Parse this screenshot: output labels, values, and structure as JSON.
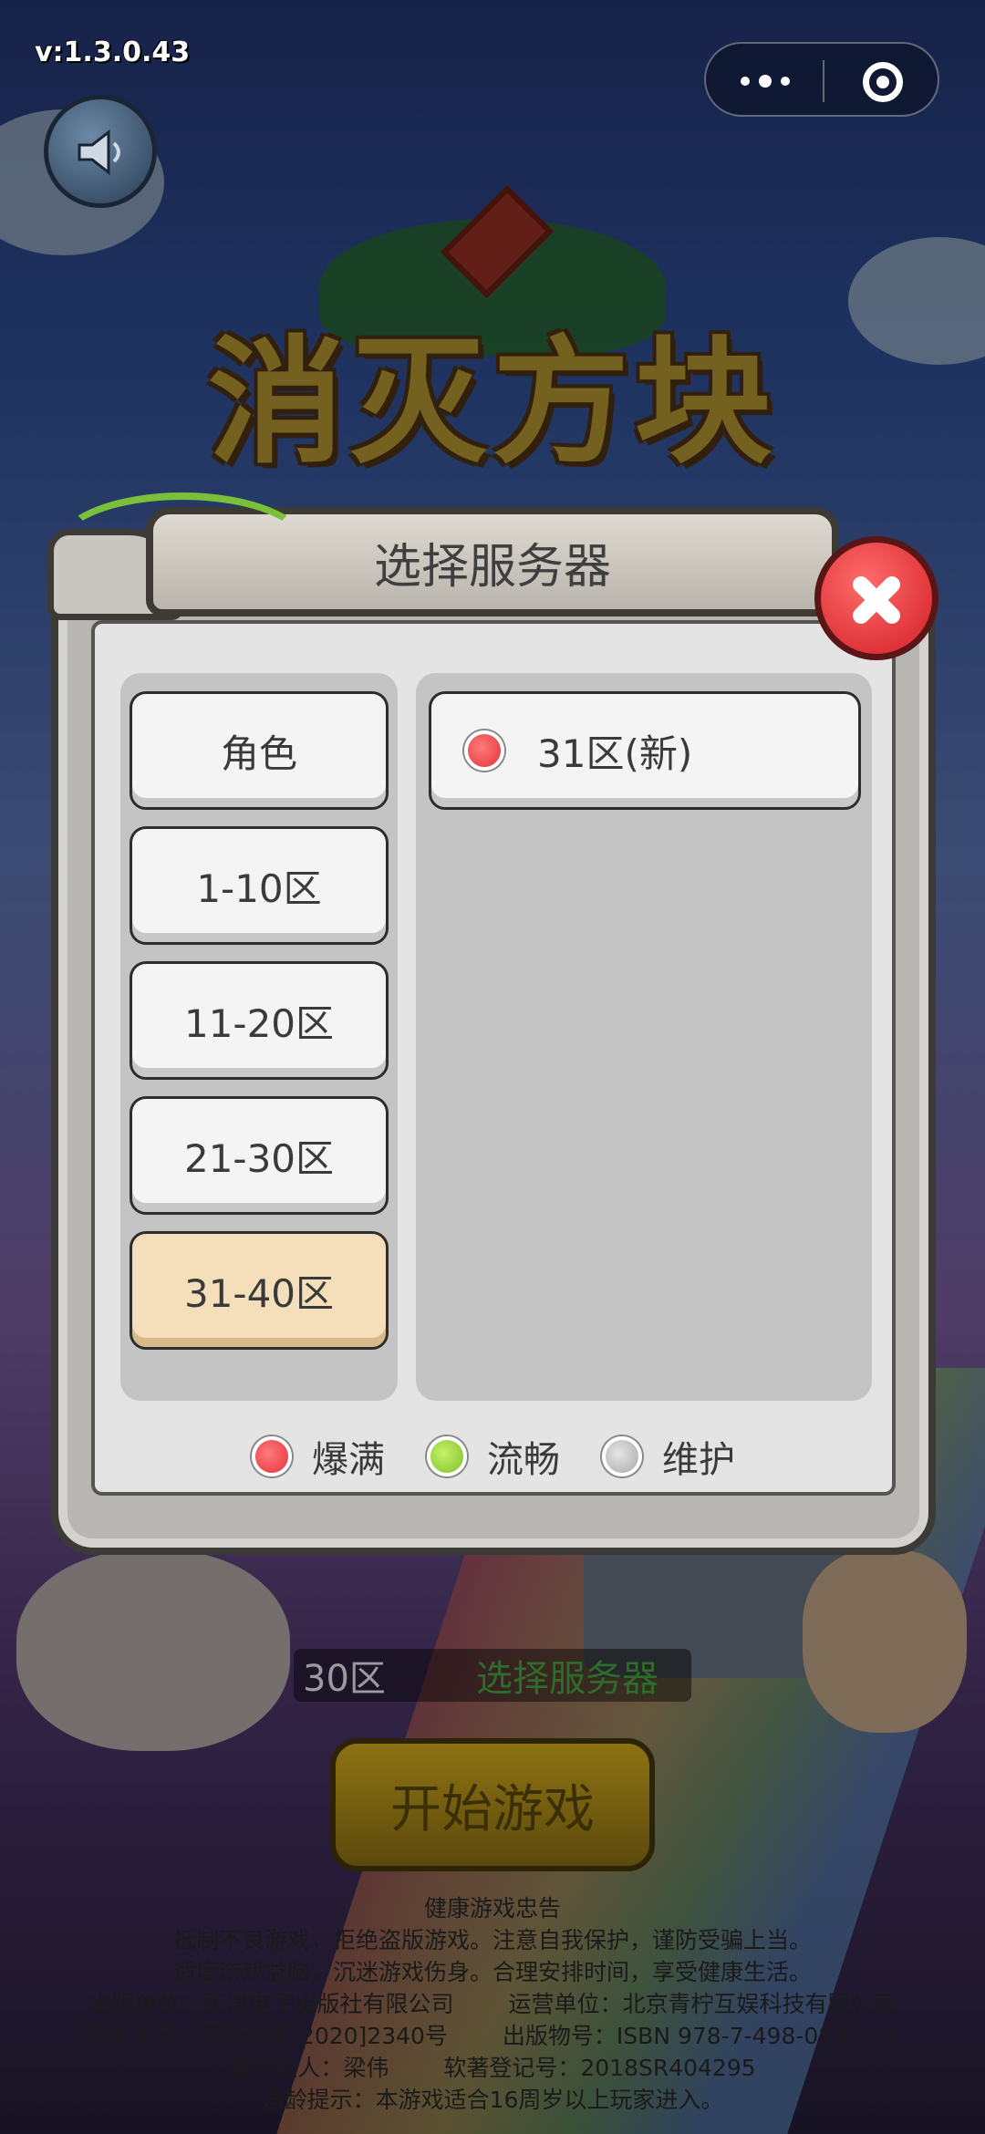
{
  "app": {
    "version": "v:1.3.0.43",
    "logo_title": "消灭方块"
  },
  "capsule": {
    "more_icon": "more-dots-icon",
    "close_icon": "close-mini-program-icon"
  },
  "dialog": {
    "title": "选择服务器",
    "tabs": [
      {
        "label": "角色",
        "active": false
      },
      {
        "label": "1-10区",
        "active": false
      },
      {
        "label": "11-20区",
        "active": false
      },
      {
        "label": "21-30区",
        "active": false
      },
      {
        "label": "31-40区",
        "active": true
      }
    ],
    "servers": [
      {
        "label": "31区(新)",
        "status": "爆满"
      }
    ],
    "legend": [
      {
        "label": "爆满",
        "color": "#e3323c"
      },
      {
        "label": "流畅",
        "color": "#7cc22a"
      },
      {
        "label": "维护",
        "color": "#a8a8a8"
      }
    ]
  },
  "bottom": {
    "current_server": "30区",
    "choose_server": "选择服务器",
    "start_button": "开始游戏"
  },
  "notice": {
    "title": "健康游戏忠告",
    "line1": "抵制不良游戏，拒绝盗版游戏。注意自我保护，谨防受骗上当。",
    "line2": "适度游戏益脑，沉迷游戏伤身。合理安排时间，享受健康生活。",
    "publisher": "出版单位：天津电子出版社有限公司",
    "operator": "运营单位：北京青柠互娱科技有限公司",
    "approval": "审批文号：国新出审[2020]2340号",
    "isbn": "出版物号：ISBN 978-7-498-08321-0",
    "copyright": "著作权人：梁伟",
    "software_reg": "软著登记号：2018SR404295",
    "age_tip": "适龄提示：本游戏适合16周岁以上玩家进入。"
  }
}
